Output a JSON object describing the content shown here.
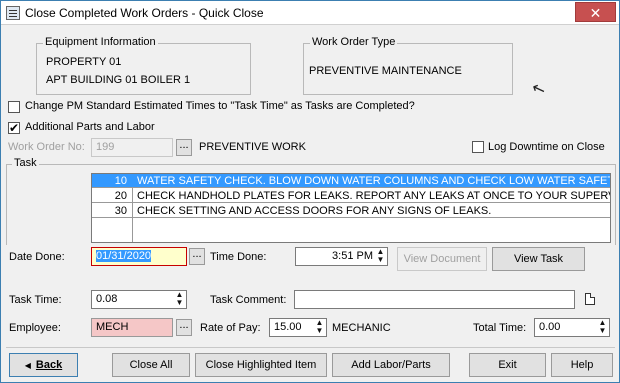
{
  "window": {
    "title": "Close Completed Work Orders - Quick Close",
    "close_label": "✕"
  },
  "equipment": {
    "legend": "Equipment Information",
    "line1": "PROPERTY 01",
    "line2": "APT BUILDING 01 BOILER 1"
  },
  "work_order_type": {
    "legend": "Work Order Type",
    "value": "PREVENTIVE MAINTENANCE"
  },
  "options": {
    "change_pm_label": "Change PM Standard Estimated Times to \"Task Time\" as Tasks are Completed?",
    "additional_parts_label": "Additional Parts and Labor",
    "additional_parts_checked": "✔",
    "log_downtime_label": "Log Downtime on Close"
  },
  "work_order": {
    "label": "Work Order No:",
    "value": "199",
    "browse_label": "...",
    "description": "PREVENTIVE WORK"
  },
  "task_group": {
    "legend": "Task"
  },
  "tasks": [
    {
      "number": "10",
      "text": "WATER SAFETY CHECK. BLOW DOWN WATER COLUMNS AND CHECK LOW WATER SAFETIES. IF TH"
    },
    {
      "number": "20",
      "text": "CHECK HANDHOLD PLATES FOR LEAKS. REPORT ANY LEAKS AT ONCE TO YOUR SUPERVISOR."
    },
    {
      "number": "30",
      "text": "CHECK SETTING AND ACCESS DOORS FOR ANY SIGNS OF LEAKS."
    }
  ],
  "date_done": {
    "label": "Date Done:",
    "value": "01/31/2020",
    "browse_label": "..."
  },
  "time_done": {
    "label": "Time Done:",
    "value": "3:51 PM"
  },
  "buttons": {
    "view_document": "View Document",
    "view_task": "View Task",
    "back": "Back",
    "close_all": "Close All",
    "close_highlighted": "Close Highlighted Item",
    "add_labor_parts": "Add Labor/Parts",
    "exit": "Exit",
    "help": "Help"
  },
  "task_time": {
    "label": "Task Time:",
    "value": "0.08"
  },
  "task_comment": {
    "label": "Task Comment:",
    "value": ""
  },
  "employee": {
    "label": "Employee:",
    "value": "MECH",
    "browse_label": "..."
  },
  "rate_of_pay": {
    "label": "Rate of Pay:",
    "value": "15.00",
    "trade": "MECHANIC"
  },
  "total_time": {
    "label": "Total Time:",
    "value": "0.00"
  },
  "icons": {
    "spin_up": "▲",
    "spin_down": "▼",
    "cursor": "↖",
    "back_arrow": "◀"
  }
}
